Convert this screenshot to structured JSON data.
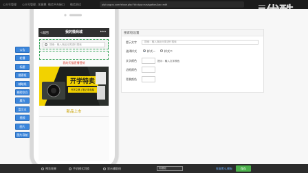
{
  "browser": {
    "tabs": [
      "公众号管理",
      "公众号管理 - 如意鼎",
      "微信平台接口",
      "微信测试",
      "微信营销管理系统"
    ],
    "url": "yiyi.sogou.com/show.php?id=dpp=navigation&ac=edit",
    "watermark": "优酷"
  },
  "sidenav": {
    "items": [
      "公告",
      "轮播",
      "标题",
      "搜索框",
      "辅助线",
      "辅助空白",
      "魔方",
      "富文本",
      "视频",
      "图片",
      "图片导航"
    ]
  },
  "phone": {
    "nav_back": "<返回",
    "nav_title": "我的微商城",
    "nav_dots": "•••",
    "search_placeholder": "搜索：输入商品分类进行搜索",
    "banner_title": "我的天猫直播营销",
    "banner_text_main": "开学特卖",
    "banner_text_sub": "开学文具 | 笔记本电脑",
    "caption": "新品上市"
  },
  "panel": {
    "title": "搜索框设置",
    "placeholder_label": "提示文字",
    "placeholder_value": "搜索：输入商品分类进行搜索",
    "style_label": "选择样式",
    "style_options": [
      "样式一",
      "样式二"
    ],
    "text_color_label": "文字颜色",
    "text_color_hint": "提示：输入文字颜色",
    "border_color_label": "边框颜色",
    "bg_color_label": "背景颜色"
  },
  "bottombar": {
    "options": [
      "预览效果",
      "手机模式切换",
      "显示辅助线"
    ],
    "field_value": "标题组",
    "link": "恢复默认模板",
    "button": "保存"
  },
  "colors": {
    "nav_blue": "#3b86dc",
    "save_green": "#4bb04b",
    "banner_yellow": "#f2d200"
  }
}
